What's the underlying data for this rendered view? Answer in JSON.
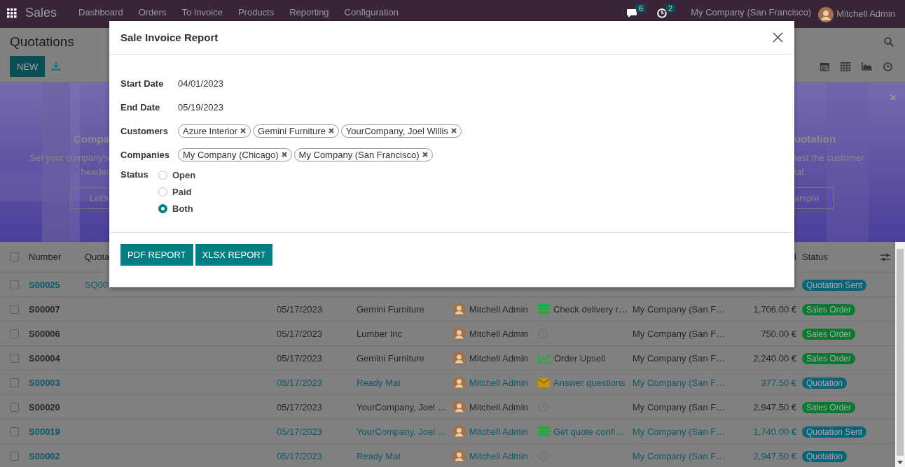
{
  "navbar": {
    "app": "Sales",
    "menu": [
      "Dashboard",
      "Orders",
      "To Invoice",
      "Products",
      "Reporting",
      "Configuration"
    ],
    "messages_badge": "6",
    "activities_badge": "2",
    "company": "My Company (San Francisco)",
    "user": "Mitchell Admin"
  },
  "control_panel": {
    "title": "Quotations",
    "new_button": "NEW"
  },
  "banner": {
    "left": {
      "title": "Compa",
      "lines": [
        "Set your company's",
        "header"
      ],
      "button": "Let's"
    },
    "right": {
      "title": "uotation",
      "lines": [
        "test the customer",
        "tal."
      ],
      "button": "ample"
    },
    "close": "×"
  },
  "table": {
    "select_all_checked": false,
    "header": {
      "number": "Number",
      "quotation": "Quota",
      "total": "l",
      "status": "Status"
    },
    "rows": [
      {
        "checked": false,
        "highlighted": true,
        "number": "S00025",
        "quotation": "SQ00",
        "status": {
          "label": "Quotation Sent",
          "color": "#0b6377"
        }
      },
      {
        "checked": false,
        "highlighted": false,
        "number": "S00007",
        "date": "05/17/2023",
        "customer": "Gemini Furniture",
        "salesperson": "Mitchell Admin",
        "activity": {
          "kind": "todo",
          "text": "Check delivery r…"
        },
        "company": "My Company (San F…",
        "total": "1,706.00 €",
        "status": {
          "label": "Sales Order",
          "color": "#0b7a30"
        }
      },
      {
        "checked": false,
        "highlighted": false,
        "number": "S00006",
        "date": "05/17/2023",
        "customer": "Lumber Inc",
        "salesperson": "Mitchell Admin",
        "activity": {
          "kind": "clock"
        },
        "company": "My Company (San F…",
        "total": "750.00 €",
        "status": {
          "label": "Sales Order",
          "color": "#0b7a30"
        }
      },
      {
        "checked": false,
        "highlighted": false,
        "number": "S00004",
        "date": "05/17/2023",
        "customer": "Gemini Furniture",
        "salesperson": "Mitchell Admin",
        "activity": {
          "kind": "upsell",
          "text": "Order Upsell"
        },
        "company": "My Company (San F…",
        "total": "2,240.00 €",
        "status": {
          "label": "Sales Order",
          "color": "#0b7a30"
        }
      },
      {
        "checked": false,
        "highlighted": true,
        "number": "S00003",
        "date": "05/17/2023",
        "customer": "Ready Mat",
        "salesperson": "Mitchell Admin",
        "activity": {
          "kind": "email",
          "text": "Answer questions"
        },
        "company": "My Company (San F…",
        "total": "377.50 €",
        "status": {
          "label": "Quotation",
          "color": "#0b6377"
        }
      },
      {
        "checked": false,
        "highlighted": false,
        "number": "S00020",
        "date": "05/17/2023",
        "customer": "YourCompany, Joel …",
        "salesperson": "Mitchell Admin",
        "activity": {
          "kind": "clock"
        },
        "company": "My Company (San F…",
        "total": "2,947.50 €",
        "status": {
          "label": "Sales Order",
          "color": "#0b7a30"
        }
      },
      {
        "checked": false,
        "highlighted": true,
        "number": "S00019",
        "date": "05/17/2023",
        "customer": "YourCompany, Joel …",
        "salesperson": "Mitchell Admin",
        "activity": {
          "kind": "todo",
          "text": "Get quote confi…"
        },
        "company": "My Company (San F…",
        "total": "1,740.00 €",
        "status": {
          "label": "Quotation Sent",
          "color": "#0b6377"
        }
      },
      {
        "checked": false,
        "highlighted": true,
        "number": "S00002",
        "date": "05/17/2023",
        "customer": "Ready Mat",
        "salesperson": "Mitchell Admin",
        "activity": {
          "kind": "clock"
        },
        "company": "My Company (San F…",
        "total": "2,947.50 €",
        "status": {
          "label": "Quotation",
          "color": "#0b6377"
        }
      }
    ]
  },
  "dialog": {
    "title": "Sale Invoice Report",
    "fields": [
      {
        "kind": "text",
        "label": "Start Date",
        "value": "04/01/2023"
      },
      {
        "kind": "text",
        "label": "End Date",
        "value": "05/19/2023"
      },
      {
        "kind": "tags",
        "label": "Customers",
        "tags": [
          "Azure Interior",
          "Gemini Furniture",
          "YourCompany, Joel Willis"
        ]
      },
      {
        "kind": "tags",
        "label": "Companies",
        "tags": [
          "My Company (Chicago)",
          "My Company (San Francisco)"
        ]
      },
      {
        "kind": "radio",
        "label": "Status",
        "options": [
          {
            "label": "Open",
            "selected": false
          },
          {
            "label": "Paid",
            "selected": false
          },
          {
            "label": "Both",
            "selected": true
          }
        ]
      }
    ],
    "buttons": [
      "PDF REPORT",
      "XLSX REPORT"
    ]
  }
}
